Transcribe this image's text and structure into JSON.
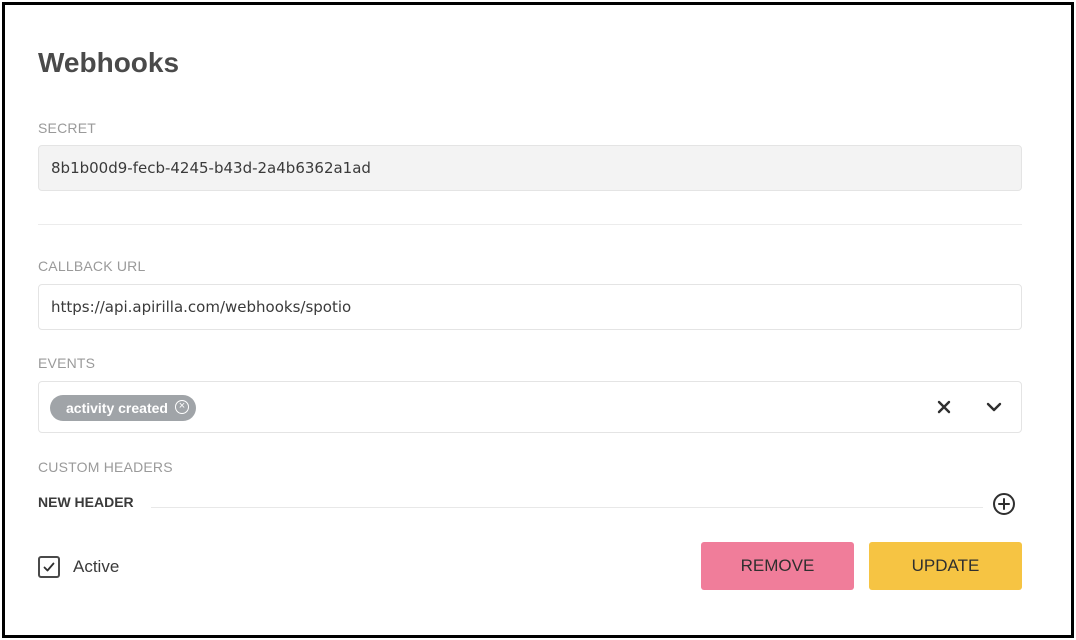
{
  "page": {
    "title": "Webhooks"
  },
  "secret": {
    "label": "SECRET",
    "value": "8b1b00d9-fecb-4245-b43d-2a4b6362a1ad"
  },
  "callback": {
    "label": "CALLBACK URL",
    "value": "https://api.apirilla.com/webhooks/spotio"
  },
  "events": {
    "label": "EVENTS",
    "selected": [
      "activity created"
    ],
    "icons": {
      "chip_remove": "circle-x-icon",
      "clear": "close-icon",
      "expand": "chevron-down-icon"
    }
  },
  "custom_headers": {
    "label": "CUSTOM HEADERS",
    "new_header_label": "NEW HEADER",
    "add_icon": "plus-circle-icon"
  },
  "active": {
    "label": "Active",
    "checked": true
  },
  "actions": {
    "remove_label": "REMOVE",
    "update_label": "UPDATE"
  },
  "colors": {
    "remove_bg": "#f07d9a",
    "update_bg": "#f6c443",
    "chip_bg": "#a0a4a8",
    "readonly_field_bg": "#f3f3f3"
  }
}
